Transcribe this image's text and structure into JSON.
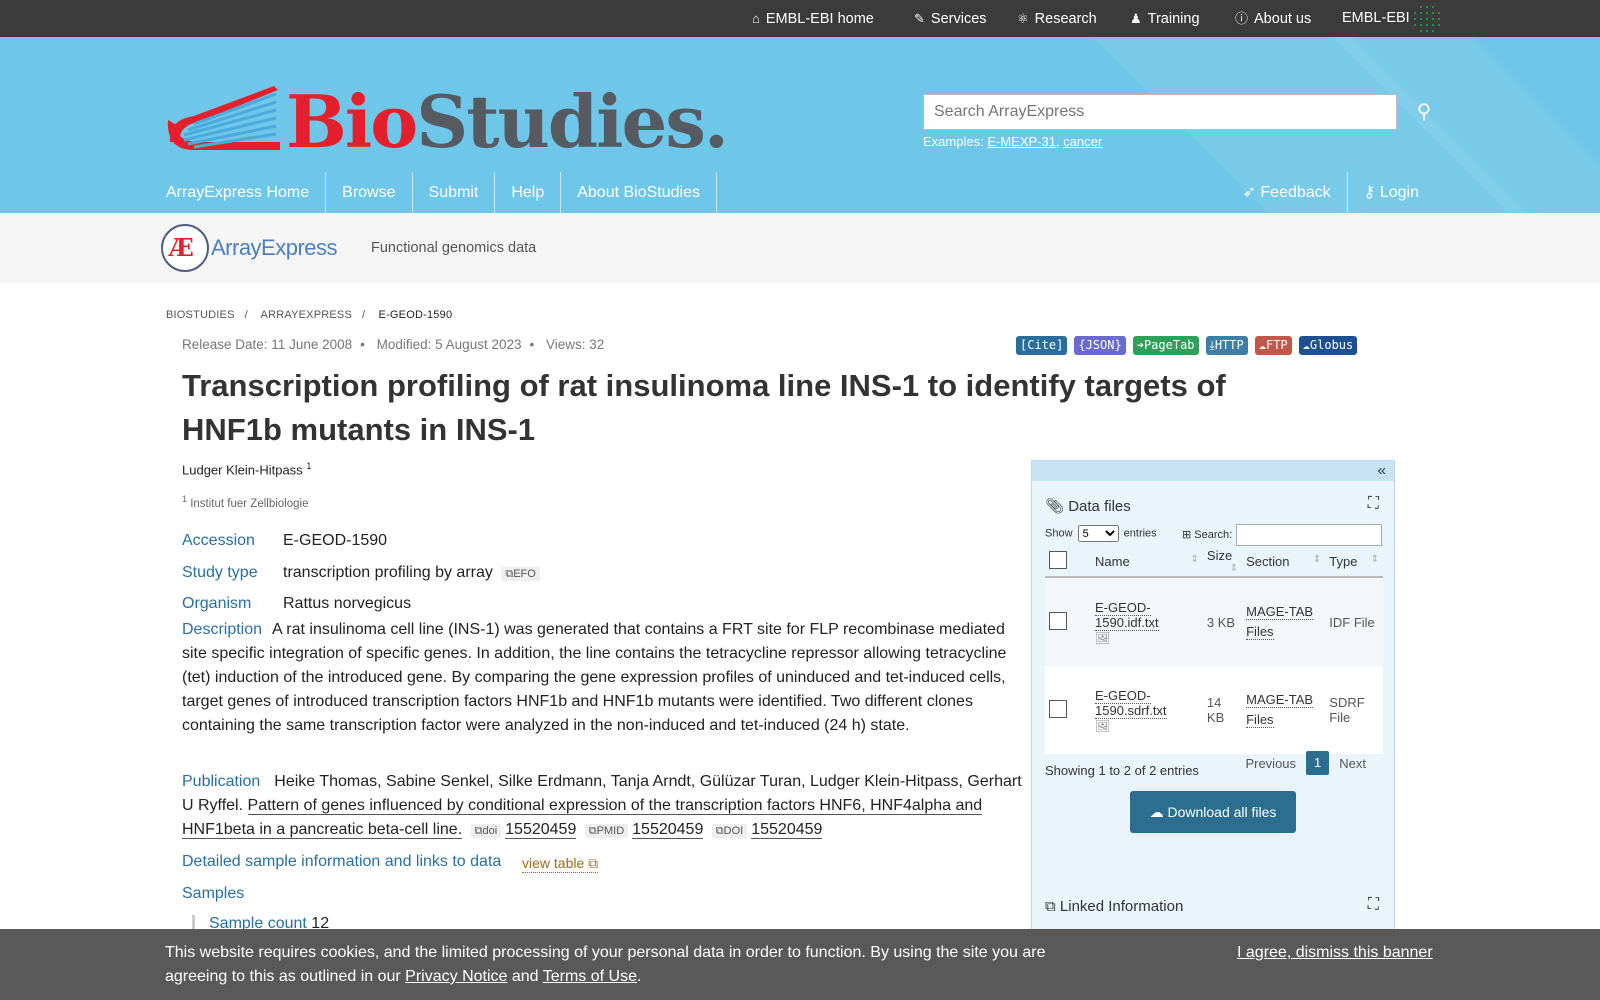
{
  "topbar": {
    "items": [
      {
        "label": "EMBL-EBI home",
        "icon": "home-icon"
      },
      {
        "label": "Services",
        "icon": "wrench-icon"
      },
      {
        "label": "Research",
        "icon": "research-icon"
      },
      {
        "label": "Training",
        "icon": "training-icon"
      },
      {
        "label": "About us",
        "icon": "info-icon"
      }
    ],
    "org": "EMBL-EBI"
  },
  "header": {
    "logo_bio": "Bio",
    "logo_studies": "Studies.",
    "search_placeholder": "Search ArrayExpress",
    "examples_label": "Examples:",
    "example1": "E-MEXP-31",
    "example2": "cancer",
    "nav": [
      "ArrayExpress Home",
      "Browse",
      "Submit",
      "Help",
      "About BioStudies"
    ],
    "feedback": "Feedback",
    "login": "Login"
  },
  "subheader": {
    "brand": "ArrayExpress",
    "tagline": "Functional genomics data"
  },
  "breadcrumb": [
    "BIOSTUDIES",
    "ARRAYEXPRESS",
    "E-GEOD-1590"
  ],
  "meta": {
    "release": "Release Date: 11 June 2008",
    "modified": "Modified: 5 August 2023",
    "views": "Views: 32"
  },
  "badges": [
    {
      "label": "[Cite]",
      "color": "#2b6e9e"
    },
    {
      "label": "{JSON}",
      "color": "#6b6bcf"
    },
    {
      "label": "➔PageTab",
      "color": "#2fa05a"
    },
    {
      "label": "HTTP",
      "color": "#3f7fa6"
    },
    {
      "label": "FTP",
      "color": "#c0574b"
    },
    {
      "label": "Globus",
      "color": "#1d4f91"
    }
  ],
  "study": {
    "title": "Transcription profiling of rat insulinoma line INS-1 to identify targets of HNF1b mutants in INS-1",
    "author": "Ludger Klein-Hitpass",
    "author_sup": "1",
    "affil_sup": "1",
    "affiliation": "Institut fuer Zellbiologie",
    "accession_label": "Accession",
    "accession": "E-GEOD-1590",
    "study_type_label": "Study type",
    "study_type": "transcription profiling by array",
    "efo": "EFO",
    "organism_label": "Organism",
    "organism": "Rattus norvegicus",
    "description_label": "Description",
    "description": "A rat insulinoma cell line (INS-1) was generated that contains a FRT site for FLP recombinase mediated site specific integration of specific genes. In addition, the line contains the tetracycline repressor allowing tetracycline (tet) induction of the introduced gene. By comparing the gene expression profiles of uninduced and tet-induced cells, target genes of introduced transcription factors HNF1b and HNF1b mutants were identified. Two different clones containing the same transcription factor were analyzed in the non-induced and tet-induced (24 h) state.",
    "publication_label": "Publication",
    "pub_authors": "Heike Thomas, Sabine Senkel, Silke Erdmann, Tanja Arndt, Gülüzar Turan, Ludger Klein-Hitpass, Gerhart U Ryffel.",
    "pub_title": "Pattern of genes influenced by conditional expression of the transcription factors HNF6, HNF4alpha and HNF1beta in a pancreatic beta-cell line.",
    "doi_tag": "doi",
    "pmid_tag": "PMID",
    "doi2_tag": "DOI",
    "pub_id": "15520459",
    "detail_label": "Detailed sample information and links to data",
    "view_table": "view table",
    "samples_label": "Samples",
    "sample_count_label": "Sample count",
    "sample_count": "12"
  },
  "datafiles": {
    "title": "Data files",
    "show": "Show",
    "entries": "entries",
    "per_page": "5",
    "search_label": "Search:",
    "columns": [
      "Name",
      "Size",
      "Section",
      "Type"
    ],
    "rows": [
      {
        "name": "E-GEOD-1590.idf.txt",
        "size": "3 KB",
        "section": "MAGE-TAB Files",
        "type": "IDF File"
      },
      {
        "name": "E-GEOD-1590.sdrf.txt",
        "size": "14 KB",
        "section": "MAGE-TAB Files",
        "type": "SDRF File"
      }
    ],
    "showing": "Showing 1 to 2 of 2 entries",
    "previous": "Previous",
    "page": "1",
    "next": "Next",
    "download_all": "Download all files",
    "linked_title": "Linked Information"
  },
  "cookie": {
    "text1": "This website requires cookies, and the limited processing of your personal data in order to function. By using the site you are agreeing to this as outlined in our",
    "privacy": "Privacy Notice",
    "and": "and",
    "terms": "Terms of Use",
    "period": ".",
    "agree": "I agree, dismiss this banner"
  }
}
